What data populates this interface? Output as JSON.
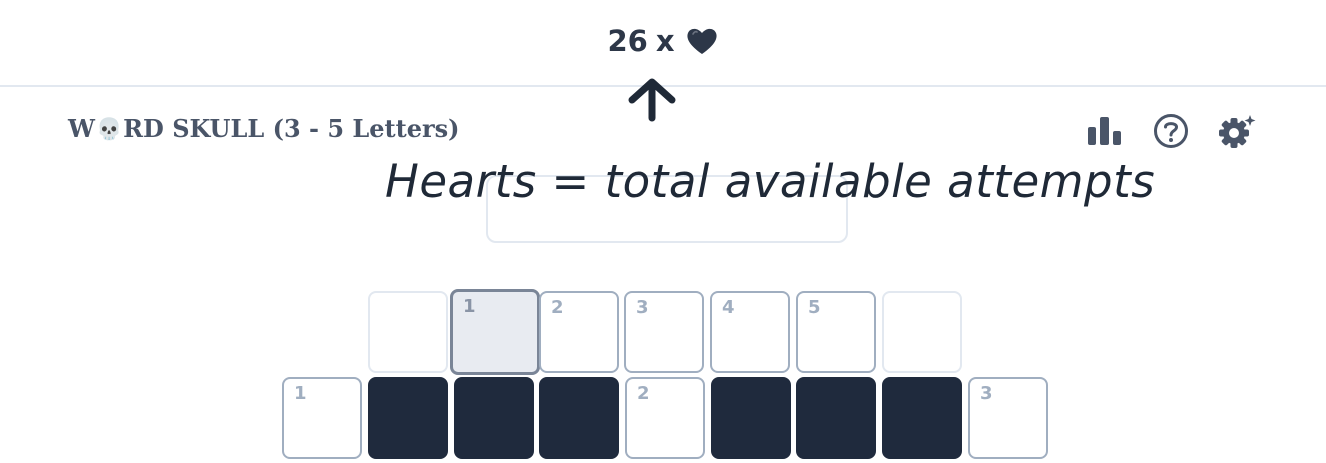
{
  "header": {
    "hearts_count": "26",
    "hearts_separator": "x",
    "heart_icon": "black-heart-icon",
    "heart_color": "#2d3748"
  },
  "game": {
    "title_prefix": "W",
    "title_icon": "💀",
    "title_rest": "RD SKULL (3 - 5 Letters)"
  },
  "toolbar": {
    "icons": [
      "stats-icon",
      "help-icon",
      "settings-icon"
    ]
  },
  "annotation": {
    "text": "Hearts = total available attempts",
    "arrow_icon": "arrow-up-icon"
  },
  "grid": {
    "row1": [
      "",
      "1",
      "2",
      "3",
      "4",
      "5",
      ""
    ],
    "row2": [
      "1",
      "",
      "",
      "",
      "2",
      "",
      "",
      "",
      "3"
    ],
    "blocked_color": "#1f2a3d"
  }
}
